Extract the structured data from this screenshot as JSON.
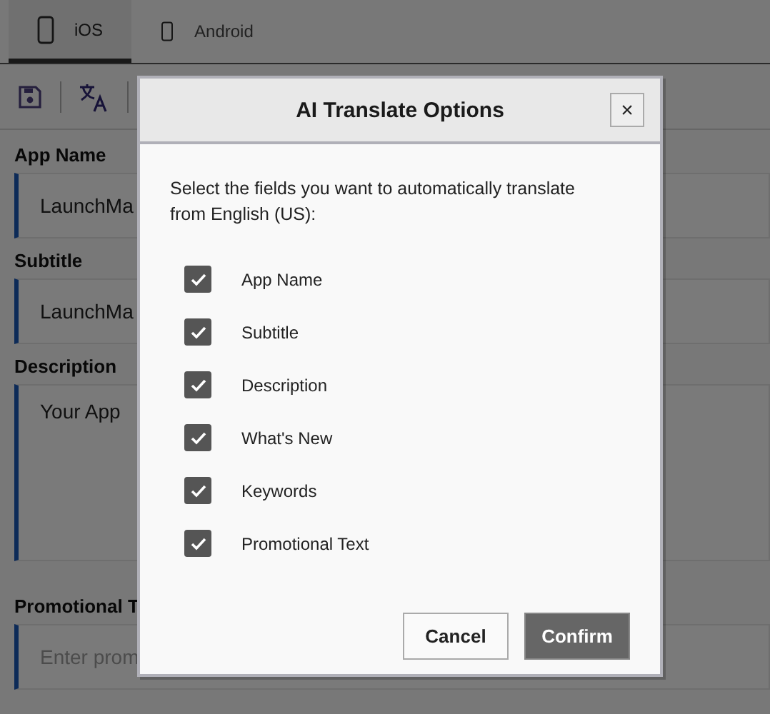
{
  "tabs": [
    {
      "label": "iOS",
      "selected": true
    },
    {
      "label": "Android",
      "selected": false
    }
  ],
  "fields": [
    {
      "label": "App Name",
      "value": "LaunchMa",
      "kind": "input"
    },
    {
      "label": "Subtitle",
      "value": "LaunchMa",
      "kind": "input"
    },
    {
      "label": "Description",
      "value": "Your App",
      "kind": "textarea"
    },
    {
      "label": "Promotional T",
      "placeholder": "Enter prom",
      "kind": "input"
    }
  ],
  "dialog": {
    "title": "AI Translate Options",
    "close": "×",
    "prompt": "Select the fields you want to automatically translate from English (US):",
    "options": [
      {
        "label": "App Name",
        "checked": true
      },
      {
        "label": "Subtitle",
        "checked": true
      },
      {
        "label": "Description",
        "checked": true
      },
      {
        "label": "What's New",
        "checked": true
      },
      {
        "label": "Keywords",
        "checked": true
      },
      {
        "label": "Promotional Text",
        "checked": true
      }
    ],
    "buttons": [
      {
        "label": "Cancel",
        "kind": "secondary"
      },
      {
        "label": "Confirm",
        "kind": "primary"
      }
    ]
  }
}
